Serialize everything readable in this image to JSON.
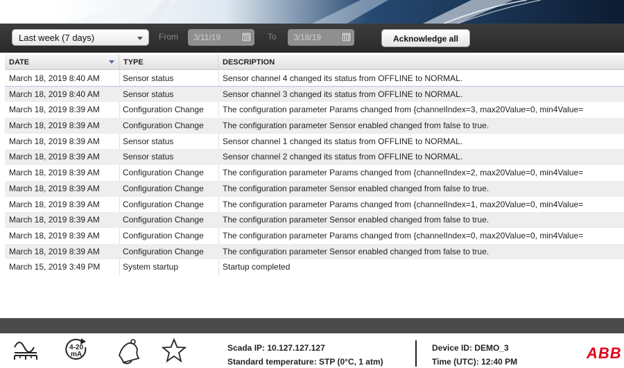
{
  "toolbar": {
    "range_value": "Last week (7 days)",
    "from_label": "From",
    "from_date": "3/11/19",
    "to_label": "To",
    "to_date": "3/18/19",
    "acknowledge_label": "Acknowledge all"
  },
  "table": {
    "columns": [
      "DATE",
      "TYPE",
      "DESCRIPTION"
    ],
    "sort_column": "DATE",
    "rows": [
      {
        "date": "March 18, 2019 8:40 AM",
        "type": "Sensor status",
        "description": "Sensor channel 4 changed its status from OFFLINE to NORMAL."
      },
      {
        "date": "March 18, 2019 8:40 AM",
        "type": "Sensor status",
        "description": "Sensor channel 3 changed its status from OFFLINE to NORMAL."
      },
      {
        "date": "March 18, 2019 8:39 AM",
        "type": "Configuration Change",
        "description": "The configuration parameter Params changed from {channelIndex=3, max20Value=0, min4Value="
      },
      {
        "date": "March 18, 2019 8:39 AM",
        "type": "Configuration Change",
        "description": "The configuration parameter Sensor enabled changed from false to true."
      },
      {
        "date": "March 18, 2019 8:39 AM",
        "type": "Sensor status",
        "description": "Sensor channel 1 changed its status from OFFLINE to NORMAL."
      },
      {
        "date": "March 18, 2019 8:39 AM",
        "type": "Sensor status",
        "description": "Sensor channel 2 changed its status from OFFLINE to NORMAL."
      },
      {
        "date": "March 18, 2019 8:39 AM",
        "type": "Configuration Change",
        "description": "The configuration parameter Params changed from {channelIndex=2, max20Value=0, min4Value="
      },
      {
        "date": "March 18, 2019 8:39 AM",
        "type": "Configuration Change",
        "description": "The configuration parameter Sensor enabled changed from false to true."
      },
      {
        "date": "March 18, 2019 8:39 AM",
        "type": "Configuration Change",
        "description": "The configuration parameter Params changed from {channelIndex=1, max20Value=0, min4Value="
      },
      {
        "date": "March 18, 2019 8:39 AM",
        "type": "Configuration Change",
        "description": "The configuration parameter Sensor enabled changed from false to true."
      },
      {
        "date": "March 18, 2019 8:39 AM",
        "type": "Configuration Change",
        "description": "The configuration parameter Params changed from {channelIndex=0, max20Value=0, min4Value="
      },
      {
        "date": "March 18, 2019 8:39 AM",
        "type": "Configuration Change",
        "description": "The configuration parameter Sensor enabled changed from false to true."
      },
      {
        "date": "March 15, 2019 3:49 PM",
        "type": "System startup",
        "description": "Startup completed"
      }
    ]
  },
  "footer": {
    "icons": [
      "waveform-icon",
      "current-loop-icon",
      "bell-icon",
      "star-icon"
    ],
    "loop_icon_text": "4-20\nmA",
    "scada_ip": "Scada IP: 10.127.127.127",
    "standard_temperature": "Standard temperature: STP (0°C, 1 atm)",
    "device_id": "Device ID: DEMO_3",
    "time_utc": "Time (UTC): 12:40 PM",
    "brand": "ABB",
    "brand_color": "#e2001a"
  }
}
